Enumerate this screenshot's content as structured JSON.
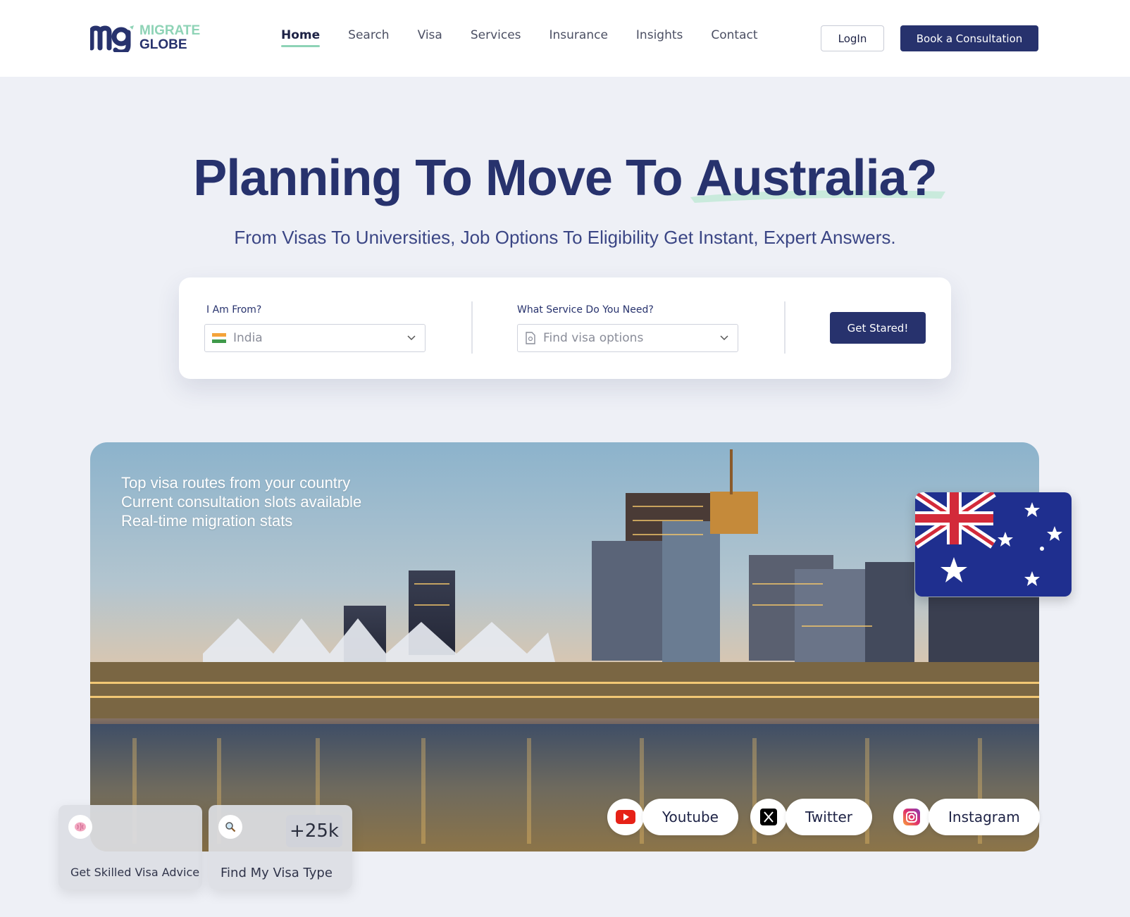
{
  "brand": {
    "line1": "MIGRATE",
    "line2": "GLOBE"
  },
  "nav": {
    "items": [
      {
        "label": "Home",
        "active": true
      },
      {
        "label": "Search"
      },
      {
        "label": "Visa"
      },
      {
        "label": "Services"
      },
      {
        "label": "Insurance"
      },
      {
        "label": "Insights"
      },
      {
        "label": "Contact"
      }
    ],
    "login_label": "LogIn",
    "consult_label": "Book a Consultation"
  },
  "hero": {
    "title_prefix": "Planning To Move To ",
    "title_highlight": "Australia?",
    "subtitle": "From Visas To Universities, Job Options To Eligibility Get Instant, Expert Answers."
  },
  "search": {
    "from_label": "I Am From?",
    "from_value": "India",
    "service_label": "What Service Do You Need?",
    "service_placeholder": "Find visa options",
    "submit_label": "Get Stared!"
  },
  "panel": {
    "lines": [
      "Top visa routes from your country",
      "Current consultation slots available",
      "Real-time migration stats"
    ]
  },
  "social": [
    {
      "label": "Youtube",
      "icon": "youtube-icon"
    },
    {
      "label": "Twitter",
      "icon": "x-icon"
    },
    {
      "label": "Instagram",
      "icon": "instagram-icon"
    }
  ],
  "cards": {
    "advice": {
      "label": "Get Skilled Visa Advice",
      "icon": "brain-icon"
    },
    "visa_type": {
      "label": "Find My Visa Type",
      "icon": "magnifier-icon",
      "count": "+25k"
    }
  },
  "colors": {
    "primary": "#27326d",
    "accent": "#8ed3b6",
    "background": "#eef0f6"
  }
}
